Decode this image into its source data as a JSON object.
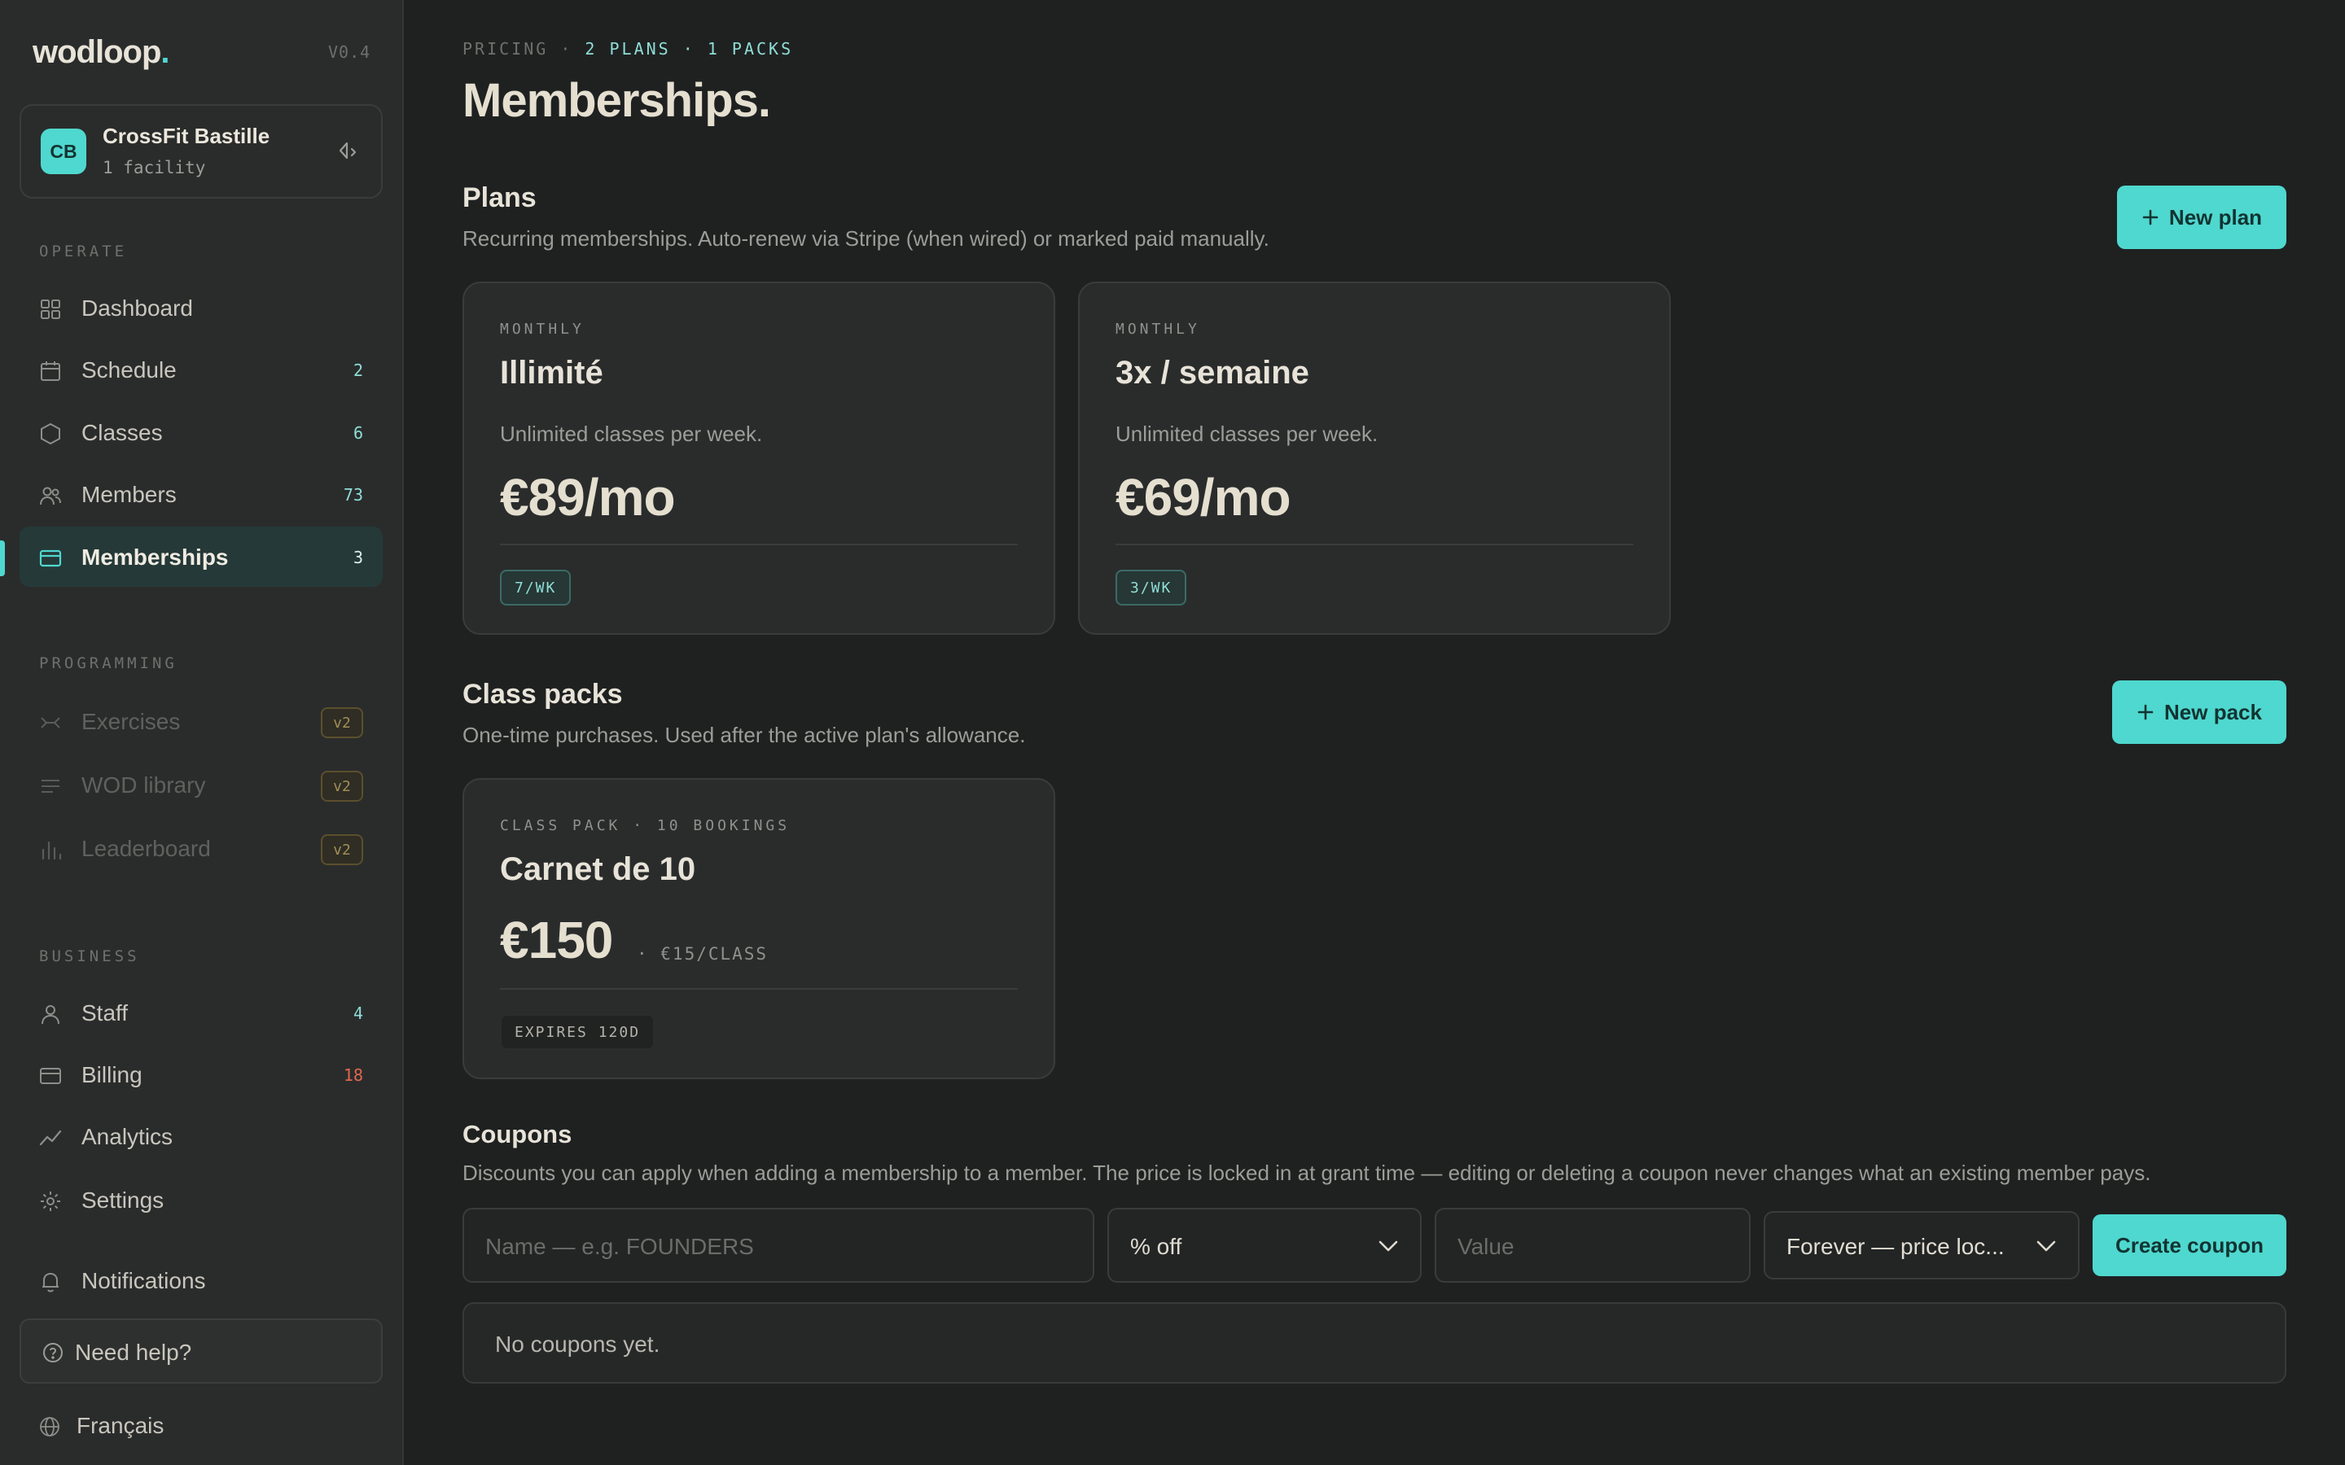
{
  "app": {
    "brand_name": "wodloop",
    "brand_dot": ".",
    "version": "V0.4",
    "accent_color": "#4fd8cf"
  },
  "org": {
    "initials": "CB",
    "name": "CrossFit Bastille",
    "subtitle": "1 facility"
  },
  "sidebar": {
    "sections": {
      "operate": "OPERATE",
      "programming": "PROGRAMMING",
      "business": "BUSINESS"
    },
    "operate_items": [
      {
        "label": "Dashboard",
        "count": "",
        "icon": "grid-icon"
      },
      {
        "label": "Schedule",
        "count": "2",
        "icon": "calendar-icon"
      },
      {
        "label": "Classes",
        "count": "6",
        "icon": "hexagon-icon"
      },
      {
        "label": "Members",
        "count": "73",
        "icon": "users-icon"
      },
      {
        "label": "Memberships",
        "count": "3",
        "icon": "card-icon",
        "active": true
      }
    ],
    "programming_items": [
      {
        "label": "Exercises",
        "badge": "v2",
        "icon": "dumbbell-icon"
      },
      {
        "label": "WOD library",
        "badge": "v2",
        "icon": "list-icon"
      },
      {
        "label": "Leaderboard",
        "badge": "v2",
        "icon": "bar-chart-icon"
      }
    ],
    "business_items": [
      {
        "label": "Staff",
        "count": "4",
        "icon": "person-icon"
      },
      {
        "label": "Billing",
        "count": "18",
        "icon": "card-icon",
        "count_color": "#e0674d"
      },
      {
        "label": "Analytics",
        "count": "",
        "icon": "trend-icon"
      },
      {
        "label": "Settings",
        "count": "",
        "icon": "gear-icon"
      }
    ],
    "notifications": "Notifications",
    "help": "Need help?",
    "language": "Français"
  },
  "header": {
    "crumb_prefix": "PRICING ·",
    "crumb_highlight": "2 PLANS · 1 PACKS",
    "title": "Memberships."
  },
  "plans": {
    "title": "Plans",
    "description": "Recurring memberships. Auto-renew via Stripe (when wired) or marked paid manually.",
    "new_button": "New plan",
    "cards": [
      {
        "kicker": "MONTHLY",
        "name": "Illimité",
        "description": "Unlimited classes per week.",
        "price": "€89/mo",
        "tag": "7/WK"
      },
      {
        "kicker": "MONTHLY",
        "name": "3x / semaine",
        "description": "Unlimited classes per week.",
        "price": "€69/mo",
        "tag": "3/WK"
      }
    ]
  },
  "packs": {
    "title": "Class packs",
    "description": "One-time purchases. Used after the active plan's allowance.",
    "new_button": "New pack",
    "cards": [
      {
        "kicker": "CLASS PACK · 10 BOOKINGS",
        "name": "Carnet de 10",
        "price": "€150",
        "per_class": "· €15/CLASS",
        "tag": "EXPIRES 120D"
      }
    ]
  },
  "coupons": {
    "title": "Coupons",
    "description": "Discounts you can apply when adding a membership to a member. The price is locked in at grant time — editing or deleting a coupon never changes what an existing member pays.",
    "name_placeholder": "Name — e.g. FOUNDERS",
    "type_value": "% off",
    "value_placeholder": "Value",
    "duration_value": "Forever — price loc...",
    "create_button": "Create coupon",
    "empty_text": "No coupons yet."
  }
}
